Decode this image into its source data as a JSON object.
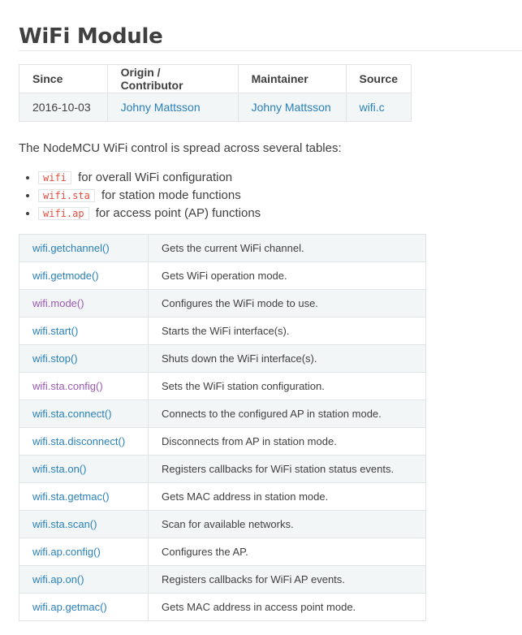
{
  "title": "WiFi Module",
  "meta": {
    "headers": [
      "Since",
      "Origin / Contributor",
      "Maintainer",
      "Source"
    ],
    "row": [
      "2016-10-03",
      "Johny Mattsson",
      "Johny Mattsson",
      "wifi.c"
    ]
  },
  "intro": "The NodeMCU WiFi control is spread across several tables:",
  "bullets": [
    {
      "code": "wifi",
      "text": "for overall WiFi configuration"
    },
    {
      "code": "wifi.sta",
      "text": "for station mode functions"
    },
    {
      "code": "wifi.ap",
      "text": "for access point (AP) functions"
    }
  ],
  "functions": [
    {
      "name": "wifi.getchannel()",
      "desc": "Gets the current WiFi channel."
    },
    {
      "name": "wifi.getmode()",
      "desc": "Gets WiFi operation mode."
    },
    {
      "name": "wifi.mode()",
      "desc": "Configures the WiFi mode to use."
    },
    {
      "name": "wifi.start()",
      "desc": "Starts the WiFi interface(s)."
    },
    {
      "name": "wifi.stop()",
      "desc": "Shuts down the WiFi interface(s)."
    },
    {
      "name": "wifi.sta.config()",
      "desc": "Sets the WiFi station configuration."
    },
    {
      "name": "wifi.sta.connect()",
      "desc": "Connects to the configured AP in station mode."
    },
    {
      "name": "wifi.sta.disconnect()",
      "desc": "Disconnects from AP in station mode."
    },
    {
      "name": "wifi.sta.on()",
      "desc": "Registers callbacks for WiFi station status events."
    },
    {
      "name": "wifi.sta.getmac()",
      "desc": "Gets MAC address in station mode."
    },
    {
      "name": "wifi.sta.scan()",
      "desc": "Scan for available networks."
    },
    {
      "name": "wifi.ap.config()",
      "desc": "Configures the AP."
    },
    {
      "name": "wifi.ap.on()",
      "desc": "Registers callbacks for WiFi AP events."
    },
    {
      "name": "wifi.ap.getmac()",
      "desc": "Gets MAC address in access point mode."
    }
  ],
  "colors": {
    "link": "#2980b9",
    "visited_link": "#9b59b6",
    "code": "#e74c3c",
    "row_alt": "#f3f6f6"
  }
}
